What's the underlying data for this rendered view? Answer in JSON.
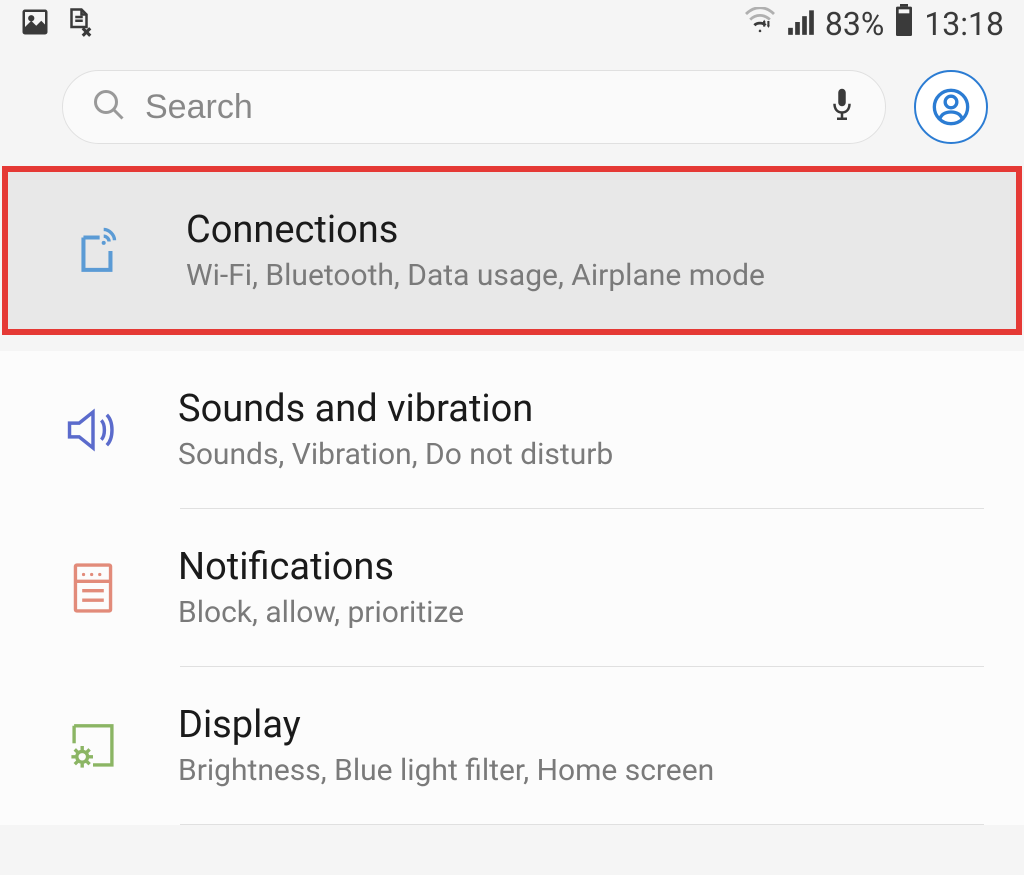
{
  "status_bar": {
    "battery_percent": "83%",
    "time": "13:18"
  },
  "search": {
    "placeholder": "Search"
  },
  "items": [
    {
      "id": "connections",
      "title": "Connections",
      "subtitle": "Wi-Fi, Bluetooth, Data usage, Airplane mode",
      "highlighted": true,
      "icon": "connections-icon",
      "icon_color": "#5b9bd5"
    },
    {
      "id": "sounds",
      "title": "Sounds and vibration",
      "subtitle": "Sounds, Vibration, Do not disturb",
      "icon": "sound-icon",
      "icon_color": "#5b6bcc"
    },
    {
      "id": "notifications",
      "title": "Notifications",
      "subtitle": "Block, allow, prioritize",
      "icon": "notifications-icon",
      "icon_color": "#e28b7a"
    },
    {
      "id": "display",
      "title": "Display",
      "subtitle": "Brightness, Blue light filter, Home screen",
      "icon": "display-icon",
      "icon_color": "#8bb564"
    }
  ]
}
